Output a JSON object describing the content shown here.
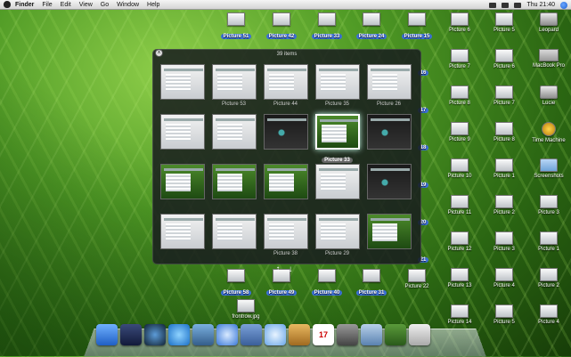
{
  "menubar": {
    "menus": [
      "Finder",
      "File",
      "Edit",
      "View",
      "Go",
      "Window",
      "Help"
    ],
    "clock": "Thu 21:40"
  },
  "desktop": {
    "top_row_selected": [
      "Picture 51",
      "Picture 42",
      "Picture 33",
      "Picture 24",
      "Picture 15"
    ],
    "right_icons": [
      [
        "Picture 6",
        "Picture 5",
        "Leopard"
      ],
      [
        "Picture 7",
        "Picture 6",
        "MacBook Pro"
      ],
      [
        "Picture 8",
        "Picture 7",
        "Lucie"
      ],
      [
        "Picture 9",
        "Picture 8",
        "Time Machine"
      ],
      [
        "Picture 10",
        "Picture 1",
        "Screenshots"
      ],
      [
        "Picture 11",
        "Picture 2",
        "Picture 3"
      ],
      [
        "Picture 12",
        "Picture 3",
        "Picture 1"
      ],
      [
        "Picture 13",
        "Picture 4",
        "Picture 2"
      ],
      [
        "Picture 14",
        "Picture 5",
        "Picture 4"
      ]
    ],
    "side_numbers": [
      "16",
      "17",
      "18",
      "19",
      "20",
      "21"
    ],
    "bottom_selected": [
      "Picture 58",
      "Picture 49",
      "Picture 40",
      "Picture 31"
    ],
    "bottom_extra": "Picture 22",
    "bottom_file": "frontrow.jpg"
  },
  "stack": {
    "title": "39 items",
    "close": "x",
    "labels": [
      "Picture 53",
      "Picture 44",
      "Picture 35",
      "Picture 26",
      "Picture 33",
      "Picture 38",
      "Picture 29"
    ],
    "selected_label": "Picture 33"
  },
  "dock": {
    "calendar_day": "17"
  },
  "colors": {
    "selection": "#3b6fd6",
    "stack_bg": "#191c1e"
  }
}
